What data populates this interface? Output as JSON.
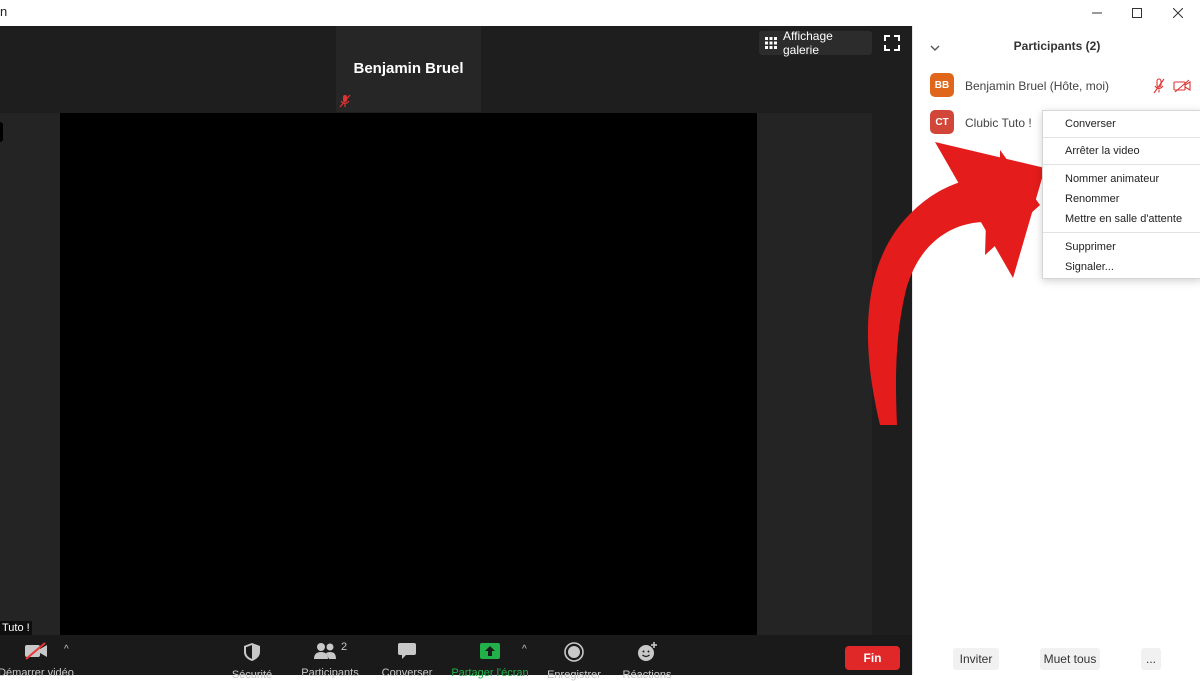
{
  "window": {
    "title_fragment": "n",
    "minimize_icon": "minimize-icon",
    "maximize_icon": "maximize-icon",
    "close_icon": "close-icon"
  },
  "video": {
    "active_speaker": "Benjamin Bruel",
    "view_button": "Affichage galerie",
    "self_tile_name": "Tuto !"
  },
  "toolbar": {
    "items": [
      {
        "label": "Démarrer vidéo",
        "icon": "video-off-icon"
      },
      {
        "label": "Sécurité",
        "icon": "shield-icon"
      },
      {
        "label": "Participants",
        "icon": "participants-icon",
        "count": "2"
      },
      {
        "label": "Converser",
        "icon": "chat-icon"
      },
      {
        "label": "Partager l'écran",
        "icon": "share-screen-icon"
      },
      {
        "label": "Enregistrer",
        "icon": "record-icon"
      },
      {
        "label": "Réactions",
        "icon": "reactions-icon"
      }
    ],
    "end_label": "Fin"
  },
  "panel": {
    "title": "Participants (2)",
    "participants": [
      {
        "initials": "BB",
        "name": "Benjamin Bruel (Hôte, moi)",
        "color": "#e0661b"
      },
      {
        "initials": "CT",
        "name": "Clubic Tuto !",
        "color": "#d2463a"
      }
    ],
    "context_menu": [
      "Converser",
      "Arrêter la video",
      "Nommer animateur",
      "Renommer",
      "Mettre en salle d'attente",
      "Supprimer",
      "Signaler..."
    ],
    "invite_label": "Inviter",
    "mute_all_label": "Muet tous",
    "more_label": "..."
  },
  "colors": {
    "share_green": "#22b04b",
    "end_red": "#e02828",
    "arrow_red": "#e41c1c"
  }
}
